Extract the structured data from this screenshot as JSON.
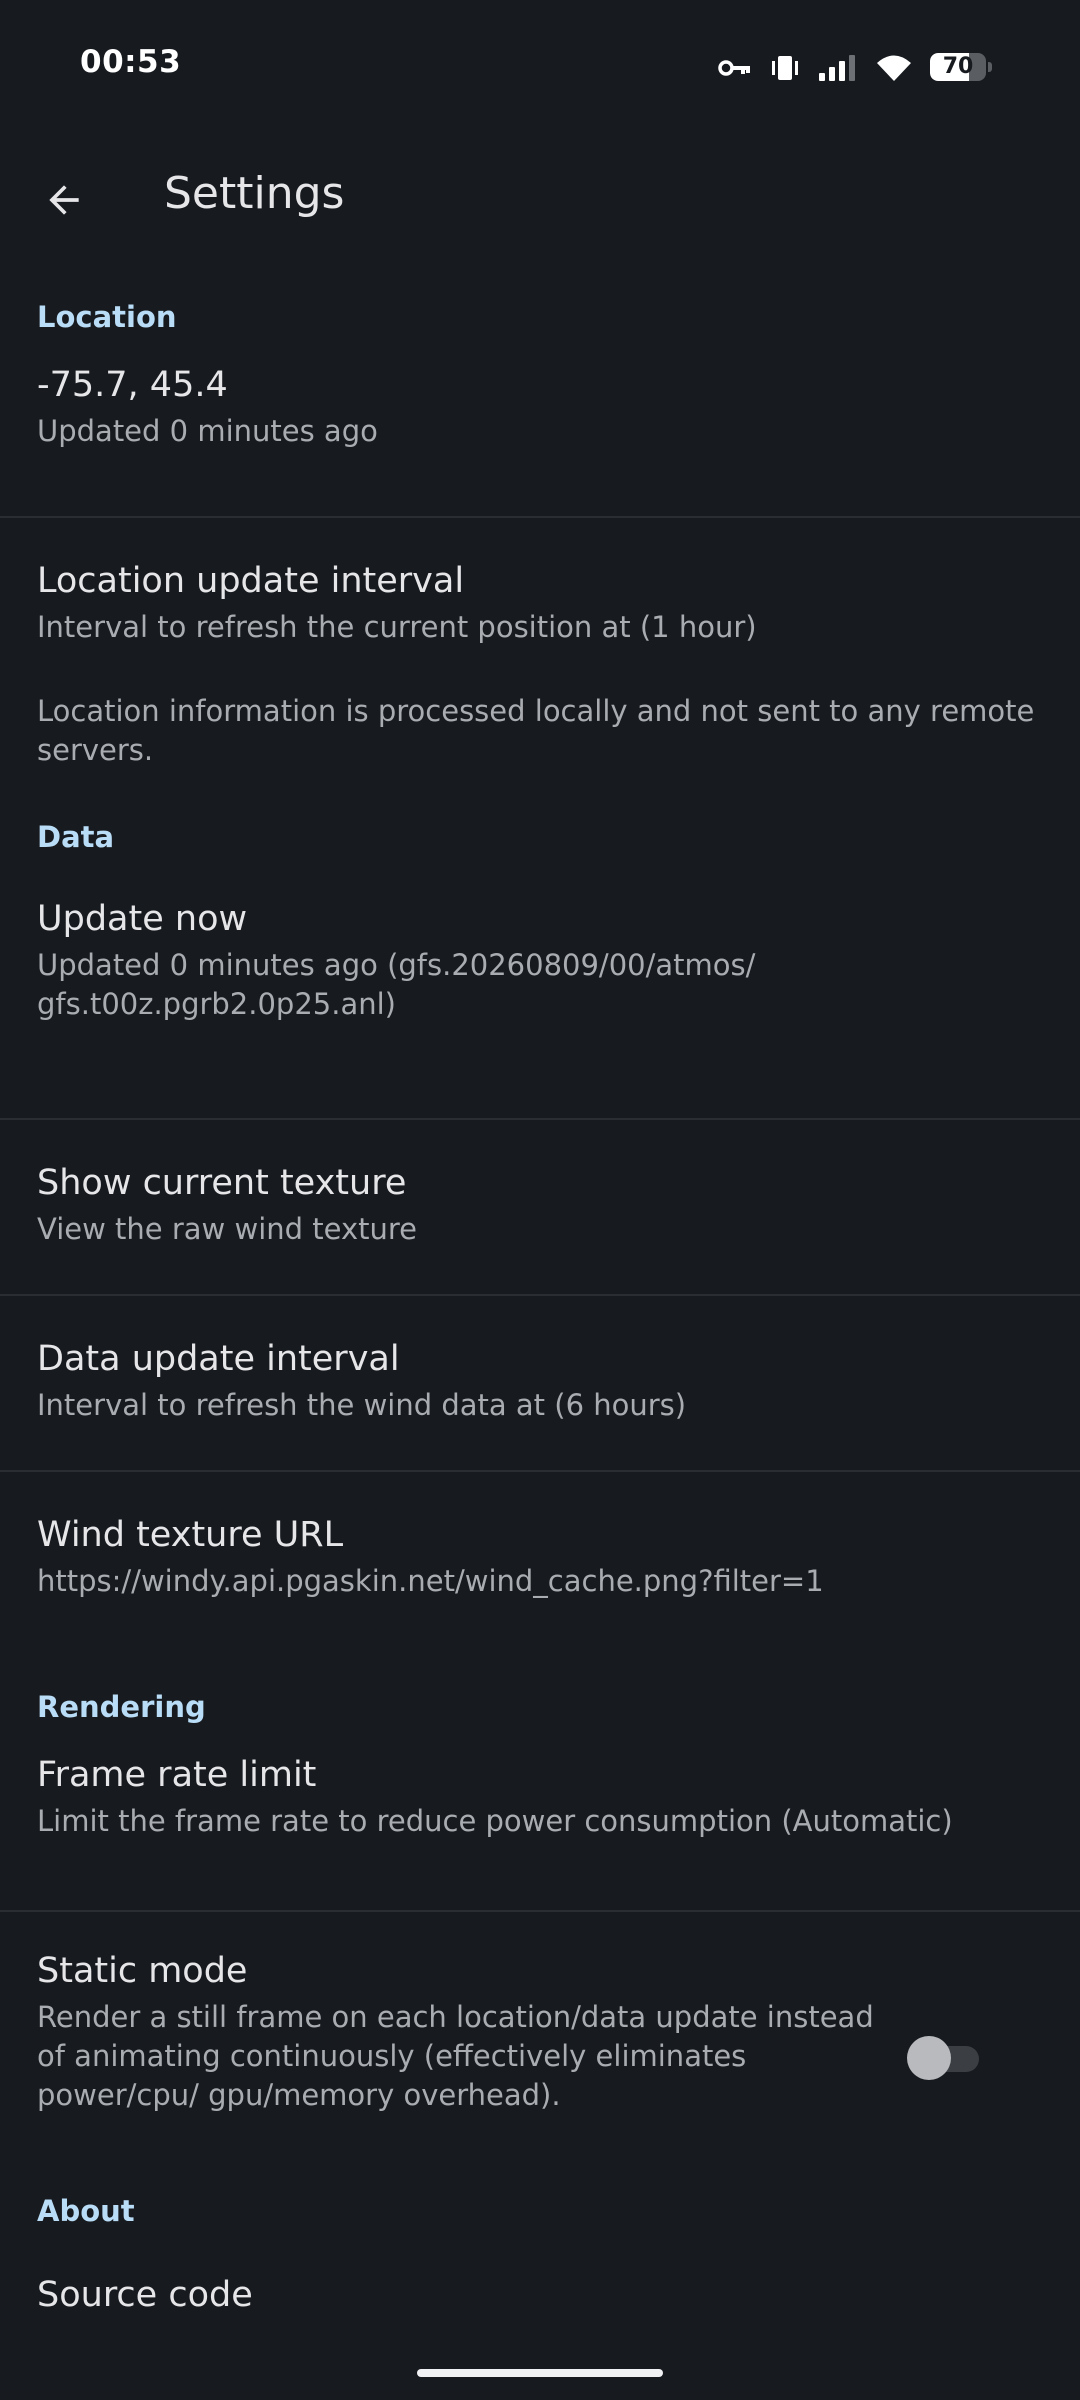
{
  "status_bar": {
    "time": "00:53",
    "icons": [
      "vpn-key-icon",
      "vibrate-icon",
      "cell-signal-icon",
      "wifi-icon",
      "battery-icon"
    ],
    "battery_level": "70",
    "battery_fraction": 0.7
  },
  "app_bar": {
    "title": "Settings",
    "back_icon": "arrow-back-icon"
  },
  "sections": {
    "location": {
      "header": "Location",
      "current": {
        "title": "-75.7, 45.4",
        "summary": "Updated 0 minutes ago"
      },
      "update_interval": {
        "title": "Location update interval",
        "summary": "Interval to refresh the current position at (1 hour)"
      },
      "privacy_note": "Location information is processed locally and not sent to any remote servers."
    },
    "data": {
      "header": "Data",
      "update_now": {
        "title": "Update now",
        "summary": "Updated 0 minutes ago (gfs.20260809/00/atmos/ gfs.t00z.pgrb2.0p25.anl)"
      },
      "show_texture": {
        "title": "Show current texture",
        "summary": "View the raw wind texture"
      },
      "update_interval": {
        "title": "Data update interval",
        "summary": "Interval to refresh the wind data at (6 hours)"
      },
      "texture_url": {
        "title": "Wind texture URL",
        "summary": "https://windy.api.pgaskin.net/wind_cache.png?filter=1"
      }
    },
    "rendering": {
      "header": "Rendering",
      "frame_rate": {
        "title": "Frame rate limit",
        "summary": "Limit the frame rate to reduce power consumption (Automatic)"
      },
      "static_mode": {
        "title": "Static mode",
        "summary": "Render a still frame on each location/data update instead of animating continuously (effectively eliminates power/cpu/ gpu/memory overhead).",
        "enabled": false
      }
    },
    "about": {
      "header": "About",
      "source_code": {
        "title": "Source code"
      }
    }
  },
  "colors": {
    "background": "#171b1f",
    "accent": "#b9dcf7",
    "title_text": "#e6e6e9",
    "summary_text": "#a9acb0",
    "divider": "#2a2e33"
  }
}
